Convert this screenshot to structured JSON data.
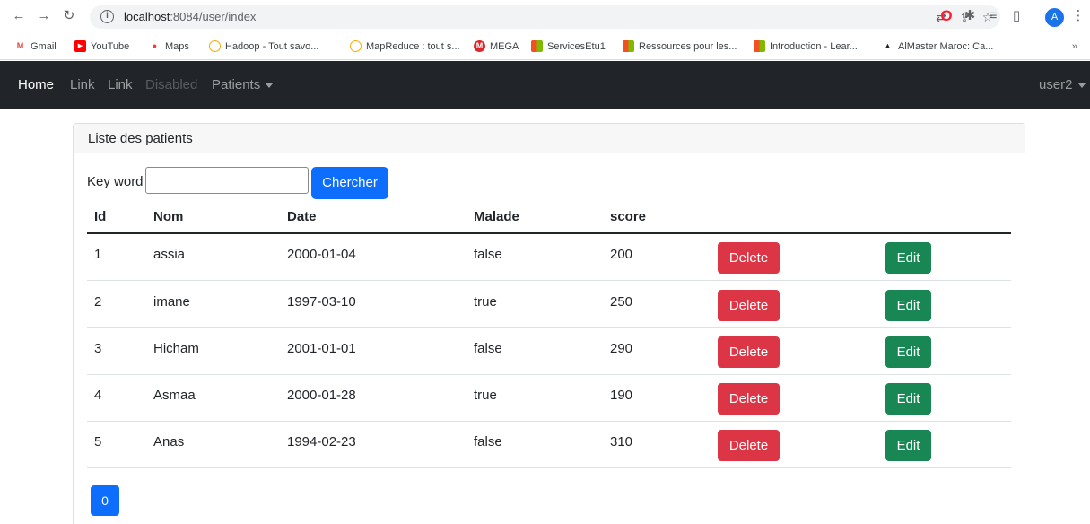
{
  "browser": {
    "url_host": "localhost",
    "url_rest": ":8084/user/index",
    "avatar_letter": "A",
    "bookmarks_more": "»"
  },
  "bookmarks": [
    {
      "label": "Gmail",
      "icon": "gmail-icon",
      "color": "#ea4335",
      "glyph": "M"
    },
    {
      "label": "YouTube",
      "icon": "youtube-icon",
      "color": "#ff0000",
      "glyph": "▶"
    },
    {
      "label": "Maps",
      "icon": "maps-icon",
      "color": "#34a853",
      "glyph": "●"
    },
    {
      "label": "Hadoop - Tout savo...",
      "icon": "bookmark-site-icon",
      "color": "#f9ab00",
      "glyph": "☺"
    },
    {
      "label": "MapReduce : tout s...",
      "icon": "bookmark-site-icon",
      "color": "#f9ab00",
      "glyph": "☺"
    },
    {
      "label": "MEGA",
      "icon": "mega-icon",
      "color": "#d9272e",
      "glyph": "M"
    },
    {
      "label": "ServicesEtu1",
      "icon": "microsoft-icon",
      "color": "#f25022",
      "glyph": "■"
    },
    {
      "label": "Ressources pour les...",
      "icon": "microsoft-icon",
      "color": "#f25022",
      "glyph": "■"
    },
    {
      "label": "Introduction - Lear...",
      "icon": "microsoft-icon",
      "color": "#f25022",
      "glyph": "■"
    },
    {
      "label": "AlMaster Maroc: Ca...",
      "icon": "graduation-cap-icon",
      "color": "#202124",
      "glyph": "▲"
    }
  ],
  "navbar": {
    "home": "Home",
    "link1": "Link",
    "link2": "Link",
    "disabled": "Disabled",
    "patients": "Patients",
    "user": "user2"
  },
  "card": {
    "header": "Liste des patients",
    "search_label": "Key word",
    "search_value": "",
    "search_button": "Chercher"
  },
  "table": {
    "headers": [
      "Id",
      "Nom",
      "Date",
      "Malade",
      "score"
    ],
    "rows": [
      {
        "id": "1",
        "nom": "assia",
        "date": "2000-01-04",
        "malade": "false",
        "score": "200"
      },
      {
        "id": "2",
        "nom": "imane",
        "date": "1997-03-10",
        "malade": "true",
        "score": "250"
      },
      {
        "id": "3",
        "nom": "Hicham",
        "date": "2001-01-01",
        "malade": "false",
        "score": "290"
      },
      {
        "id": "4",
        "nom": "Asmaa",
        "date": "2000-01-28",
        "malade": "true",
        "score": "190"
      },
      {
        "id": "5",
        "nom": "Anas",
        "date": "1994-02-23",
        "malade": "false",
        "score": "310"
      }
    ],
    "delete_label": "Delete",
    "edit_label": "Edit"
  },
  "pagination": {
    "pages": [
      "0"
    ]
  },
  "colors": {
    "navbar_bg": "#212529",
    "primary": "#0d6efd",
    "danger": "#dc3545",
    "success": "#198754"
  }
}
